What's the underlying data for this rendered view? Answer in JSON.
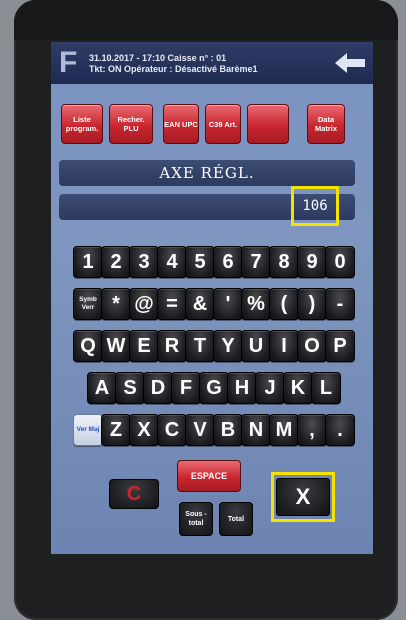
{
  "header": {
    "line1": "31.10.2017 - 17:10   Caisse n° : 01",
    "line2": "Tkt: ON Opérateur : Désactivé  Barème1",
    "logo": "F"
  },
  "functions": [
    {
      "label": "Liste program."
    },
    {
      "label": "Recher. PLU"
    },
    {
      "label": "EAN UPC"
    },
    {
      "label": "C39 Art."
    },
    {
      "label": ""
    },
    {
      "label": "Data Matrix"
    }
  ],
  "display": {
    "title": "AXE  RÉGL.",
    "value": "106"
  },
  "keyboard": {
    "row1": [
      "1",
      "2",
      "3",
      "4",
      "5",
      "6",
      "7",
      "8",
      "9",
      "0"
    ],
    "row2": [
      "Symb Verr",
      "*",
      "@",
      "=",
      "&",
      "'",
      "%",
      "(",
      ")",
      "-"
    ],
    "row3": [
      "Q",
      "W",
      "E",
      "R",
      "T",
      "Y",
      "U",
      "I",
      "O",
      "P"
    ],
    "row4": [
      "A",
      "S",
      "D",
      "F",
      "G",
      "H",
      "J",
      "K",
      "L"
    ],
    "row5": [
      "Ver Maj",
      "Z",
      "X",
      "C",
      "V",
      "B",
      "N",
      "M",
      ",",
      "."
    ]
  },
  "bottom": {
    "espace": "ESPACE",
    "clear": "C",
    "subtotal": "Sous -total",
    "total": "Total",
    "close": "X"
  },
  "colors": {
    "accent_red": "#c9262f",
    "highlight": "#f4e200",
    "screen_bg": "#7f96c0"
  }
}
